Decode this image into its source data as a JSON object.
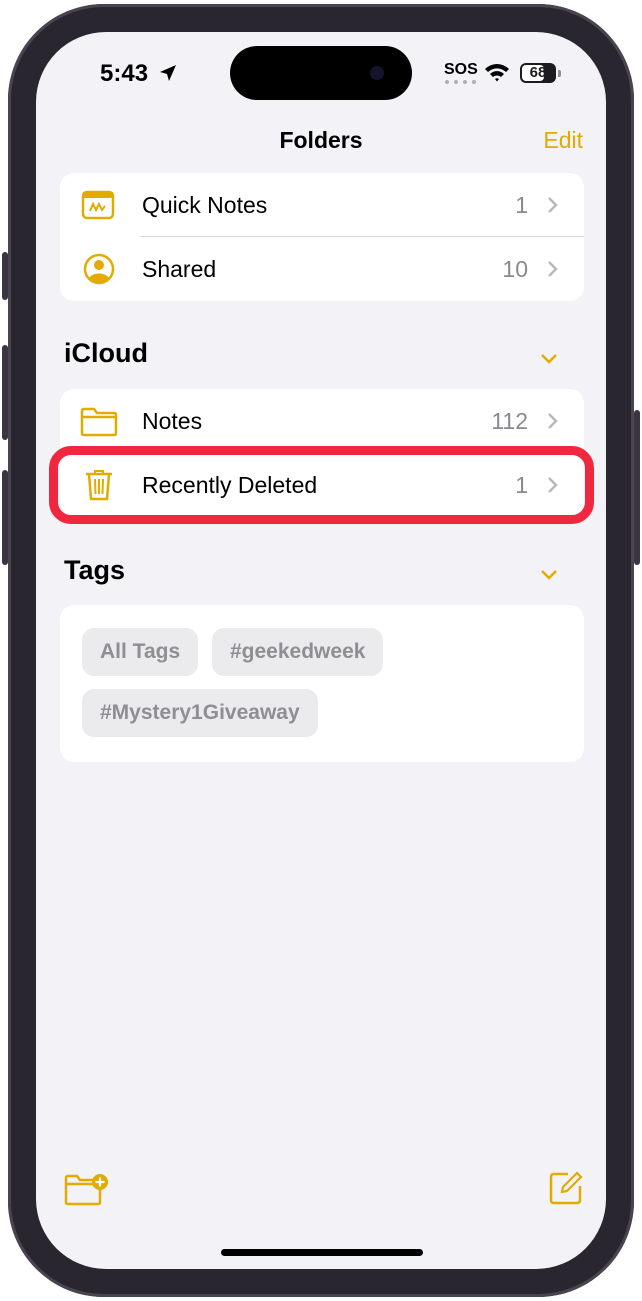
{
  "status_bar": {
    "time": "5:43",
    "sos": "SOS",
    "battery": "68"
  },
  "nav": {
    "title": "Folders",
    "edit_label": "Edit"
  },
  "top_folders": [
    {
      "label": "Quick Notes",
      "count": "1",
      "icon": "quick-note-icon"
    },
    {
      "label": "Shared",
      "count": "10",
      "icon": "shared-person-icon"
    }
  ],
  "icloud": {
    "header": "iCloud",
    "folders": [
      {
        "label": "Notes",
        "count": "112",
        "icon": "folder-icon"
      },
      {
        "label": "Recently Deleted",
        "count": "1",
        "icon": "trash-icon"
      }
    ]
  },
  "tags": {
    "header": "Tags",
    "items": [
      "All Tags",
      "#geekedweek",
      "#Mystery1Giveaway"
    ]
  },
  "toolbar": {
    "left_icon": "new-folder-icon",
    "right_icon": "compose-icon"
  },
  "colors": {
    "accent": "#e3aa00",
    "highlight": "#f0283f",
    "background": "#f2f2f7"
  }
}
